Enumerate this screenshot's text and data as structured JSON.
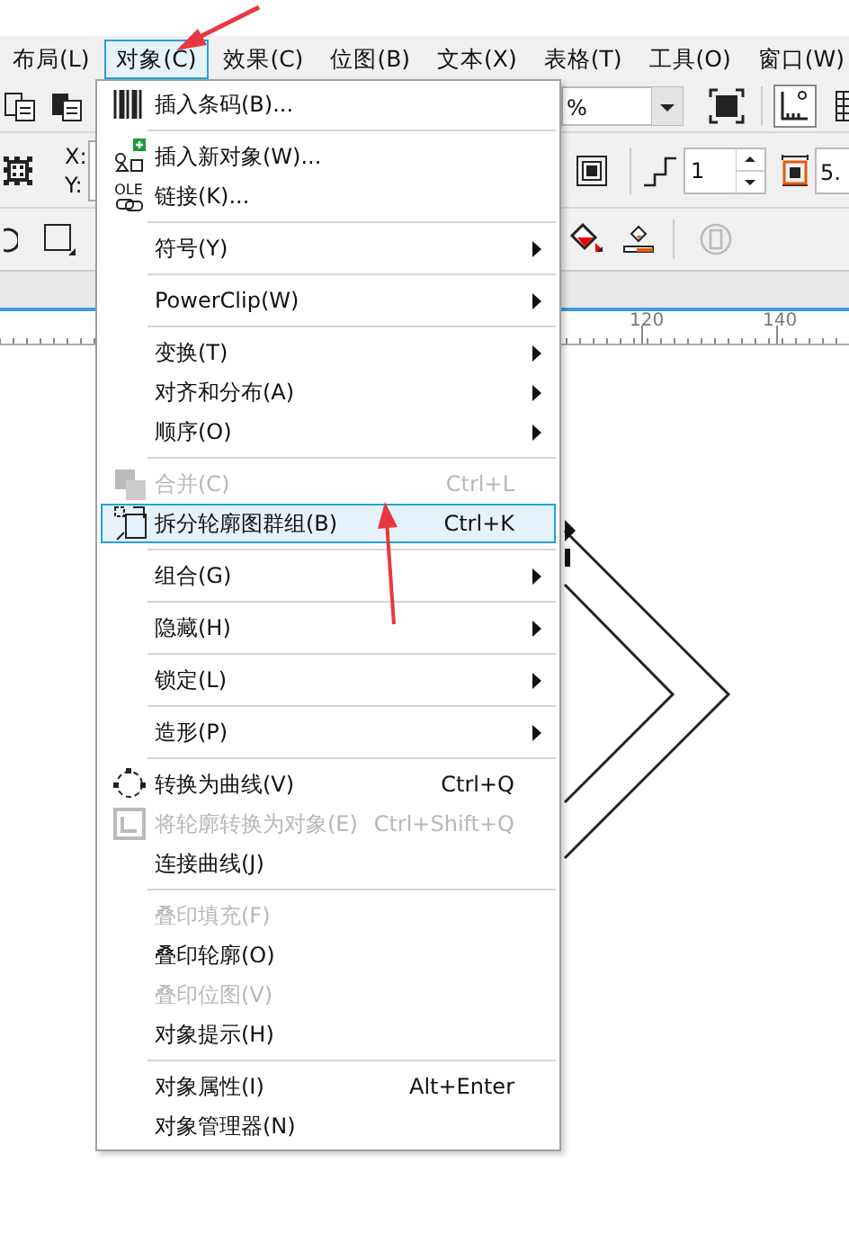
{
  "menubar": [
    {
      "label": "布局(L)",
      "selected": false
    },
    {
      "label": "对象(C)",
      "selected": true
    },
    {
      "label": "效果(C)",
      "selected": false
    },
    {
      "label": "位图(B)",
      "selected": false
    },
    {
      "label": "文本(X)",
      "selected": false
    },
    {
      "label": "表格(T)",
      "selected": false
    },
    {
      "label": "工具(O)",
      "selected": false
    },
    {
      "label": "窗口(W)",
      "selected": false
    }
  ],
  "toolbar": {
    "zoom_field": "%",
    "position_labels": [
      "X:",
      "Y:"
    ],
    "outline_field": "1",
    "size_field": "5."
  },
  "ruler": {
    "labels": [
      "120",
      "140"
    ]
  },
  "menu": {
    "items": [
      {
        "kind": "item",
        "label": "插入条码(B)...",
        "disabled": false,
        "selected": false,
        "submenu": false
      },
      {
        "kind": "separator"
      },
      {
        "kind": "item",
        "label": "插入新对象(W)...",
        "disabled": false,
        "selected": false,
        "submenu": false
      },
      {
        "kind": "item",
        "label": "链接(K)...",
        "icon_label": "OLE",
        "disabled": false,
        "selected": false,
        "submenu": false
      },
      {
        "kind": "separator"
      },
      {
        "kind": "item",
        "label": "符号(Y)",
        "disabled": false,
        "selected": false,
        "submenu": true
      },
      {
        "kind": "separator"
      },
      {
        "kind": "item",
        "label": "PowerClip(W)",
        "disabled": false,
        "selected": false,
        "submenu": true
      },
      {
        "kind": "separator"
      },
      {
        "kind": "item",
        "label": "变换(T)",
        "disabled": false,
        "selected": false,
        "submenu": true
      },
      {
        "kind": "item",
        "label": "对齐和分布(A)",
        "disabled": false,
        "selected": false,
        "submenu": true
      },
      {
        "kind": "item",
        "label": "顺序(O)",
        "disabled": false,
        "selected": false,
        "submenu": true
      },
      {
        "kind": "separator"
      },
      {
        "kind": "item",
        "label": "合并(C)",
        "shortcut": "Ctrl+L",
        "disabled": true,
        "selected": false,
        "submenu": false
      },
      {
        "kind": "item",
        "label": "拆分轮廓图群组(B)",
        "shortcut": "Ctrl+K",
        "disabled": false,
        "selected": true,
        "submenu": false
      },
      {
        "kind": "separator"
      },
      {
        "kind": "item",
        "label": "组合(G)",
        "disabled": false,
        "selected": false,
        "submenu": true
      },
      {
        "kind": "separator"
      },
      {
        "kind": "item",
        "label": "隐藏(H)",
        "disabled": false,
        "selected": false,
        "submenu": true
      },
      {
        "kind": "separator"
      },
      {
        "kind": "item",
        "label": "锁定(L)",
        "disabled": false,
        "selected": false,
        "submenu": true
      },
      {
        "kind": "separator"
      },
      {
        "kind": "item",
        "label": "造形(P)",
        "disabled": false,
        "selected": false,
        "submenu": true
      },
      {
        "kind": "separator"
      },
      {
        "kind": "item",
        "label": "转换为曲线(V)",
        "shortcut": "Ctrl+Q",
        "disabled": false,
        "selected": false,
        "submenu": false
      },
      {
        "kind": "item",
        "label": "将轮廓转换为对象(E)",
        "shortcut": "Ctrl+Shift+Q",
        "disabled": true,
        "selected": false,
        "submenu": false
      },
      {
        "kind": "item",
        "label": "连接曲线(J)",
        "disabled": false,
        "selected": false,
        "submenu": false
      },
      {
        "kind": "separator"
      },
      {
        "kind": "item",
        "label": "叠印填充(F)",
        "disabled": true,
        "selected": false,
        "submenu": false
      },
      {
        "kind": "item",
        "label": "叠印轮廓(O)",
        "disabled": false,
        "selected": false,
        "submenu": false
      },
      {
        "kind": "item",
        "label": "叠印位图(V)",
        "disabled": true,
        "selected": false,
        "submenu": false
      },
      {
        "kind": "item",
        "label": "对象提示(H)",
        "disabled": false,
        "selected": false,
        "submenu": false
      },
      {
        "kind": "separator"
      },
      {
        "kind": "item",
        "label": "对象属性(I)",
        "shortcut": "Alt+Enter",
        "disabled": false,
        "selected": false,
        "submenu": false
      },
      {
        "kind": "item",
        "label": "对象管理器(N)",
        "disabled": false,
        "selected": false,
        "submenu": false
      }
    ]
  }
}
